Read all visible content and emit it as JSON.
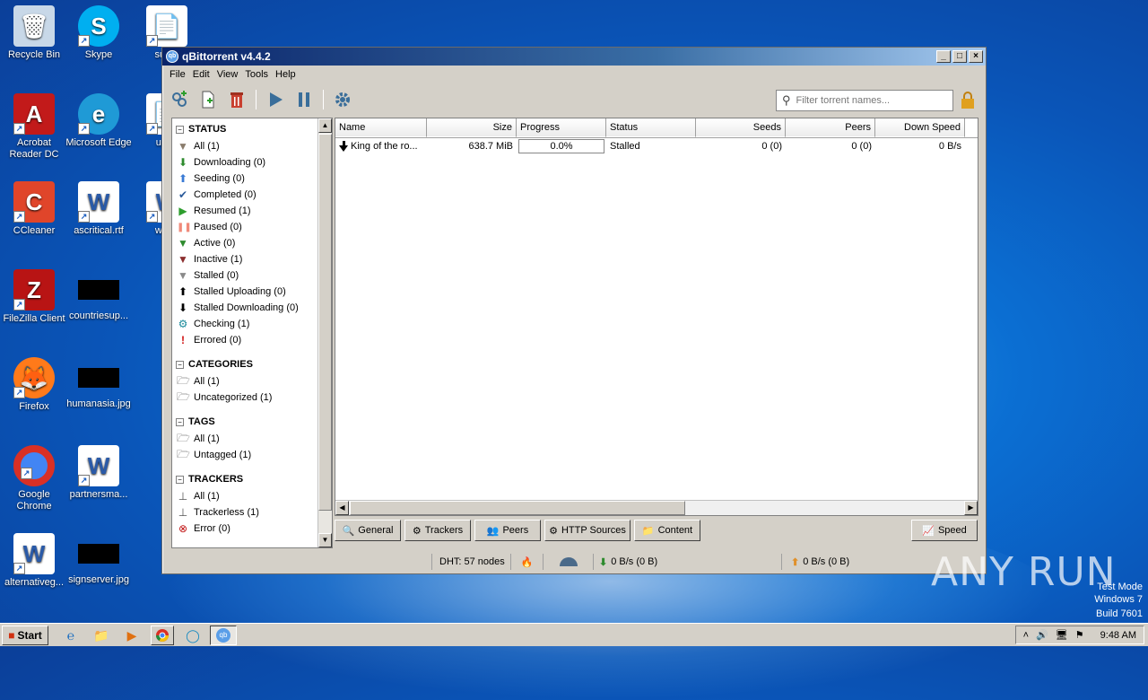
{
  "desktop": {
    "icons": [
      {
        "label": "Recycle Bin",
        "icon": "recycle-bin-icon"
      },
      {
        "label": "Skype",
        "icon": "skype-icon"
      },
      {
        "label": "subm",
        "icon": "document-icon"
      },
      {
        "label": "Acrobat Reader DC",
        "icon": "acrobat-icon"
      },
      {
        "label": "Microsoft Edge",
        "icon": "edge-icon"
      },
      {
        "label": "upda",
        "icon": "document-icon"
      },
      {
        "label": "CCleaner",
        "icon": "ccleaner-icon"
      },
      {
        "label": "ascritical.rtf",
        "icon": "word-doc-icon"
      },
      {
        "label": "wedn",
        "icon": "word-doc-icon"
      },
      {
        "label": "FileZilla Client",
        "icon": "filezilla-icon"
      },
      {
        "label": "countriesup...",
        "icon": "black-thumbnail-icon"
      },
      {
        "label": "Firefox",
        "icon": "firefox-icon"
      },
      {
        "label": "humanasia.jpg",
        "icon": "black-thumbnail-icon"
      },
      {
        "label": "Google Chrome",
        "icon": "chrome-icon"
      },
      {
        "label": "partnersma...",
        "icon": "word-doc-icon"
      },
      {
        "label": "alternativeg...",
        "icon": "word-doc-icon"
      },
      {
        "label": "signserver.jpg",
        "icon": "black-thumbnail-icon"
      }
    ]
  },
  "window": {
    "title": "qBittorrent v4.4.2",
    "menu": [
      "File",
      "Edit",
      "View",
      "Tools",
      "Help"
    ],
    "search_placeholder": "Filter torrent names...",
    "sidebar": {
      "status_title": "STATUS",
      "status_items": [
        {
          "label": "All (1)",
          "icon": "filter-icon",
          "color": "#8a7c6c"
        },
        {
          "label": "Downloading (0)",
          "icon": "download-arrow-icon",
          "color": "#2e8b2e"
        },
        {
          "label": "Seeding (0)",
          "icon": "upload-arrow-icon",
          "color": "#3a7bd5"
        },
        {
          "label": "Completed (0)",
          "icon": "checkmark-icon",
          "color": "#2a5a9a"
        },
        {
          "label": "Resumed (1)",
          "icon": "play-icon",
          "color": "#2e9e2e"
        },
        {
          "label": "Paused (0)",
          "icon": "pause-icon",
          "color": "#f08a7a"
        },
        {
          "label": "Active (0)",
          "icon": "filter-icon",
          "color": "#2e8b2e"
        },
        {
          "label": "Inactive (1)",
          "icon": "filter-icon",
          "color": "#8b2e2e"
        },
        {
          "label": "Stalled (0)",
          "icon": "filter-icon",
          "color": "#8a8a8a"
        },
        {
          "label": "Stalled Uploading (0)",
          "icon": "upload-arrow-icon",
          "color": "#000000"
        },
        {
          "label": "Stalled Downloading (0)",
          "icon": "download-arrow-icon",
          "color": "#000000"
        },
        {
          "label": "Checking (1)",
          "icon": "gear-icon",
          "color": "#1a8a9a"
        },
        {
          "label": "Errored (0)",
          "icon": "exclamation-icon",
          "color": "#d01010"
        }
      ],
      "categories_title": "CATEGORIES",
      "category_items": [
        {
          "label": "All (1)",
          "icon": "folder-icon"
        },
        {
          "label": "Uncategorized (1)",
          "icon": "folder-icon"
        }
      ],
      "tags_title": "TAGS",
      "tag_items": [
        {
          "label": "All (1)",
          "icon": "folder-icon"
        },
        {
          "label": "Untagged (1)",
          "icon": "folder-icon"
        }
      ],
      "trackers_title": "TRACKERS",
      "tracker_items": [
        {
          "label": "All (1)",
          "icon": "tracker-icon"
        },
        {
          "label": "Trackerless (1)",
          "icon": "tracker-icon"
        },
        {
          "label": "Error (0)",
          "icon": "error-circle-icon"
        }
      ]
    },
    "columns": [
      "Name",
      "Size",
      "Progress",
      "Status",
      "Seeds",
      "Peers",
      "Down Speed"
    ],
    "torrents": [
      {
        "name": "King of the ro...",
        "size": "638.7 MiB",
        "progress": "0.0%",
        "progress_value": 0.0,
        "status": "Stalled",
        "seeds": "0 (0)",
        "peers": "0 (0)",
        "down_speed": "0 B/s"
      }
    ],
    "tabs": [
      "General",
      "Trackers",
      "Peers",
      "HTTP Sources",
      "Content",
      "Speed"
    ],
    "statusbar": {
      "dht": "DHT: 57 nodes",
      "down": "0 B/s (0 B)",
      "up": "0 B/s (0 B)"
    }
  },
  "taskbar": {
    "start": "Start",
    "time": "9:48 AM"
  },
  "watermark": {
    "line1": "Test Mode",
    "line2": "Windows 7",
    "line3": "Build 7601",
    "brand": "ANY RUN"
  }
}
